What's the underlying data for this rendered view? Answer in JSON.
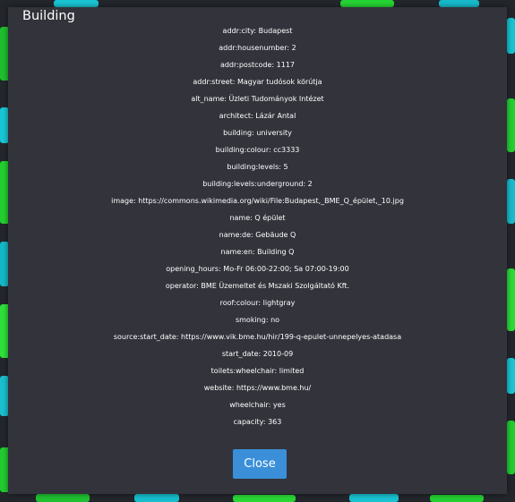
{
  "colors": {
    "dialog_background": "#32333b",
    "button_background": "#3a8fd8",
    "text": "#ffffff"
  },
  "dialog": {
    "title": "Building",
    "tags": [
      "addr:city: Budapest",
      "addr:housenumber: 2",
      "addr:postcode: 1117",
      "addr:street: Magyar tudósok körútja",
      "alt_name: Üzleti Tudományok Intézet",
      "architect: Lázár Antal",
      "building: university",
      "building:colour: cc3333",
      "building:levels: 5",
      "building:levels:underground: 2",
      "image: https://commons.wikimedia.org/wiki/File:Budapest,_BME_Q_épület,_10.jpg",
      "name: Q épület",
      "name:de: Gebäude Q",
      "name:en: Building Q",
      "opening_hours: Mo-Fr 06:00-22:00; Sa 07:00-19:00",
      "operator: BME Üzemeltet és Mszaki Szolgáltató Kft.",
      "roof:colour: lightgray",
      "smoking: no",
      "source:start_date: https://www.vik.bme.hu/hir/199-q-epulet-unnepelyes-atadasa",
      "start_date: 2010-09",
      "toilets:wheelchair: limited",
      "website: https://www.bme.hu/",
      "wheelchair: yes",
      "capacity: 363"
    ],
    "close_label": "Close"
  }
}
